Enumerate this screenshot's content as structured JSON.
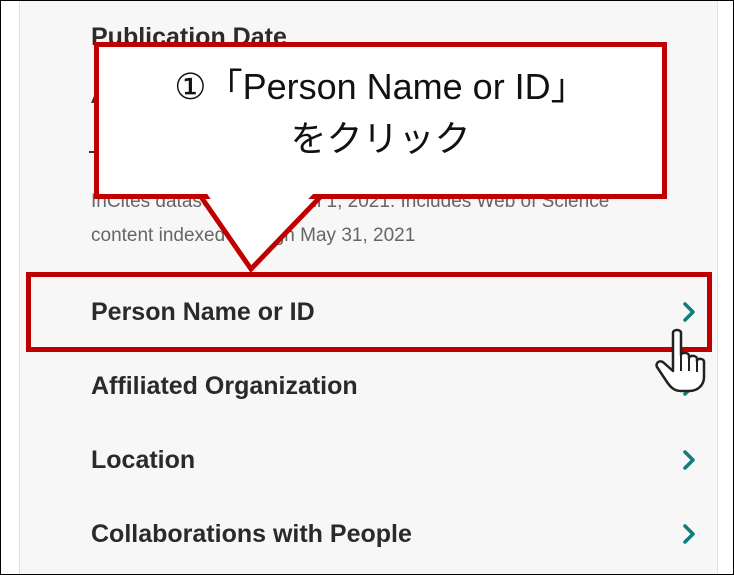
{
  "panel": {
    "section_title": "Publication Date",
    "partial_value": "A",
    "info_note": "InCites dataset updated Jul 1, 2021. Includes Web of Science content indexed through May 31, 2021"
  },
  "filters": [
    {
      "label": "Person Name or ID",
      "icon": "chevron-right-icon"
    },
    {
      "label": "Affiliated Organization",
      "icon": "chevron-right-icon"
    },
    {
      "label": "Location",
      "icon": "chevron-right-icon"
    },
    {
      "label": "Collaborations with People",
      "icon": "chevron-right-icon"
    }
  ],
  "annotation": {
    "line1": "①「Person Name or ID」",
    "line2": "をクリック"
  },
  "colors": {
    "highlight": "#c00000",
    "chevron": "#0f7d78",
    "panel_bg": "#f7f7f7"
  },
  "cursor": "hand-pointer-icon"
}
